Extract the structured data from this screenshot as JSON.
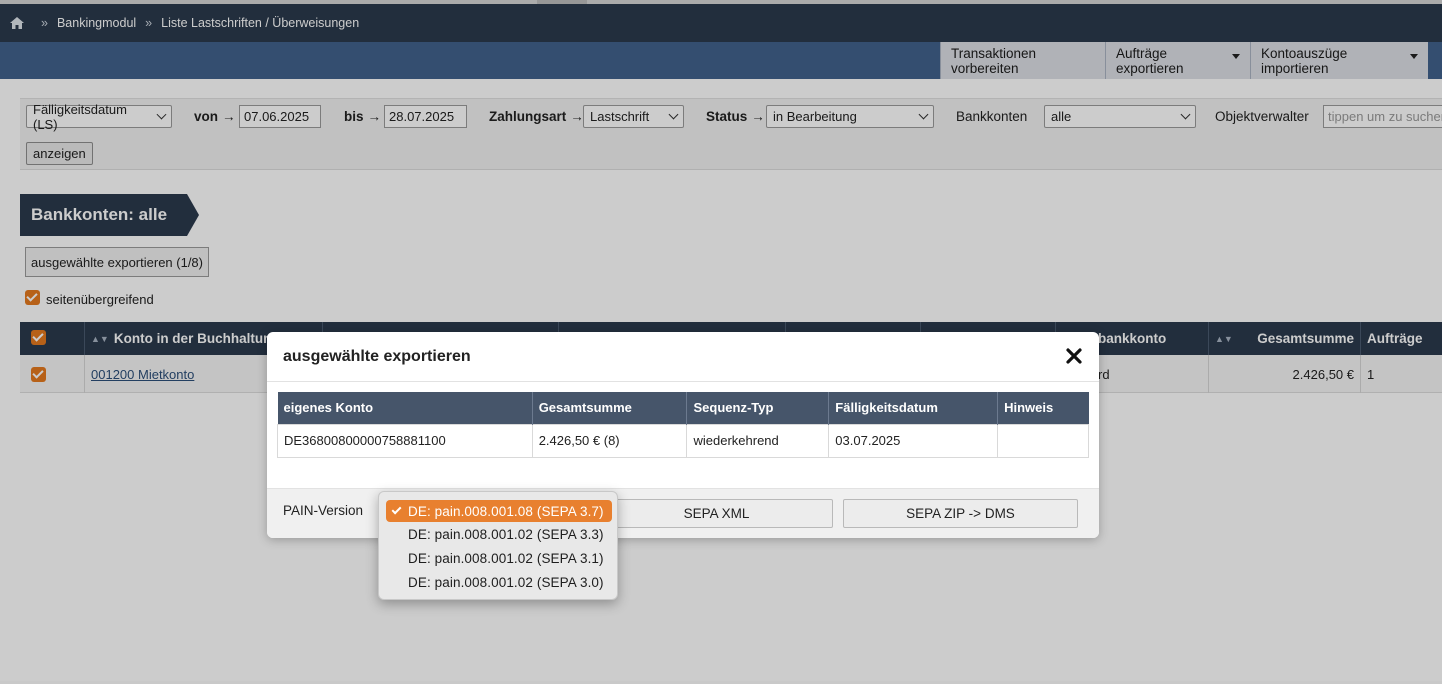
{
  "breadcrumb": {
    "items": [
      "Bankingmodul",
      "Liste Lastschriften / Überweisungen"
    ],
    "separator": "»"
  },
  "nav": {
    "prepare": "Transaktionen vorbereiten",
    "export_orders": "Aufträge exportieren",
    "import_statements": "Kontoauszüge importieren"
  },
  "filters": {
    "date_type": "Fälligkeitsdatum (LS)",
    "from_label": "von",
    "from_value": "07.06.2025",
    "to_label": "bis",
    "to_value": "28.07.2025",
    "payment_label": "Zahlungsart",
    "payment_value": "Lastschrift",
    "status_label": "Status",
    "status_value": "in Bearbeitung",
    "accounts_label": "Bankkonten",
    "accounts_value": "alle",
    "manager_label": "Objektverwalter",
    "manager_placeholder": "tippen um zu suchen",
    "arrow": "→",
    "show_button": "anzeigen"
  },
  "section": {
    "title": "Bankkonten: alle",
    "export_selected": "ausgewählte exportieren (1/8)",
    "cross_page_label": "seitenübergreifend"
  },
  "grid": {
    "headers": {
      "account": "Konto in der Buchhaltung",
      "bank_account": "bankkonto",
      "total": "Gesamtsumme",
      "orders": "Aufträge"
    },
    "row": {
      "account": "001200 Mietkonto",
      "sequence_partial": "rd",
      "total": "2.426,50 €",
      "orders": "1"
    }
  },
  "modal": {
    "title": "ausgewählte exportieren",
    "columns": [
      "eigenes Konto",
      "Gesamtsumme",
      "Sequenz-Typ",
      "Fälligkeitsdatum",
      "Hinweis"
    ],
    "rows": [
      [
        "DE36800800000758881100",
        "2.426,50 € (8)",
        "wiederkehrend",
        "03.07.2025",
        ""
      ]
    ],
    "pain_label": "PAIN-Version",
    "sepa_xml": "SEPA XML",
    "sepa_zip": "SEPA ZIP -> DMS"
  },
  "pain_dropdown": {
    "options": [
      "DE: pain.008.001.08 (SEPA 3.7)",
      "DE: pain.008.001.02 (SEPA 3.3)",
      "DE: pain.008.001.02 (SEPA 3.1)",
      "DE: pain.008.001.02 (SEPA 3.0)"
    ],
    "selected_index": 0
  },
  "colors": {
    "header_dark": "#2b3a4d",
    "nav_blue": "#42628c",
    "accent_orange": "#e8802f"
  },
  "icons": [
    "home-icon",
    "close-icon",
    "check-icon",
    "chevron-down-icon",
    "sort-icon"
  ]
}
